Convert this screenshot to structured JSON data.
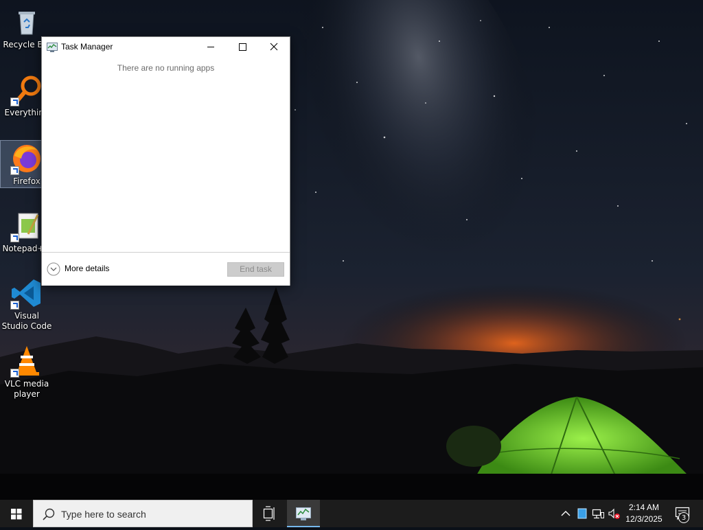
{
  "desktop": {
    "icons": [
      {
        "label": "Recycle Bin",
        "icon": "recycle-bin-icon"
      },
      {
        "label": "Everything",
        "icon": "everything-icon"
      },
      {
        "label": "Firefox",
        "icon": "firefox-icon"
      },
      {
        "label": "Notepad++",
        "icon": "notepadpp-icon"
      },
      {
        "label": "Visual Studio Code",
        "icon": "vscode-icon"
      },
      {
        "label": "VLC media player",
        "icon": "vlc-icon"
      }
    ]
  },
  "task_manager": {
    "title": "Task Manager",
    "empty_message": "There are no running apps",
    "more_details_label": "More details",
    "end_task_label": "End task"
  },
  "taskbar": {
    "search_placeholder": "Type here to search",
    "clock_time": "2:14 AM",
    "clock_date": "12/3/2025",
    "notification_count": "3"
  },
  "colors": {
    "taskbar_bg": "#1c1c1c",
    "active_underline": "#76b9ed",
    "tent_green": "#7ee03a"
  }
}
